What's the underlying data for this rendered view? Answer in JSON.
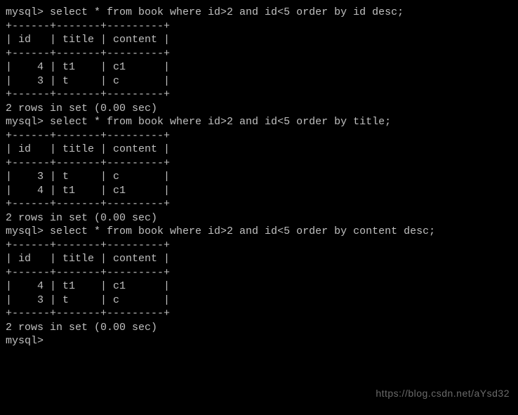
{
  "blocks": [
    {
      "prompt": "mysql>",
      "query": "select * from book where id>2 and id<5 order by id desc;",
      "table": {
        "separator": "+------+-------+---------+",
        "header": "| id   | title | content |",
        "rows": [
          "|    4 | t1    | c1      |",
          "|    3 | t     | c       |"
        ]
      },
      "footer": "2 rows in set (0.00 sec)"
    },
    {
      "prompt": "mysql>",
      "query": "select * from book where id>2 and id<5 order by title;",
      "table": {
        "separator": "+------+-------+---------+",
        "header": "| id   | title | content |",
        "rows": [
          "|    3 | t     | c       |",
          "|    4 | t1    | c1      |"
        ]
      },
      "footer": "2 rows in set (0.00 sec)"
    },
    {
      "prompt": "mysql>",
      "query": "select * from book where id>2 and id<5 order by content desc;",
      "table": {
        "separator": "+------+-------+---------+",
        "header": "| id   | title | content |",
        "rows": [
          "|    4 | t1    | c1      |",
          "|    3 | t     | c       |"
        ]
      },
      "footer": "2 rows in set (0.00 sec)"
    }
  ],
  "trailing_prompt": "mysql>",
  "watermark": "https://blog.csdn.net/aYsd32"
}
